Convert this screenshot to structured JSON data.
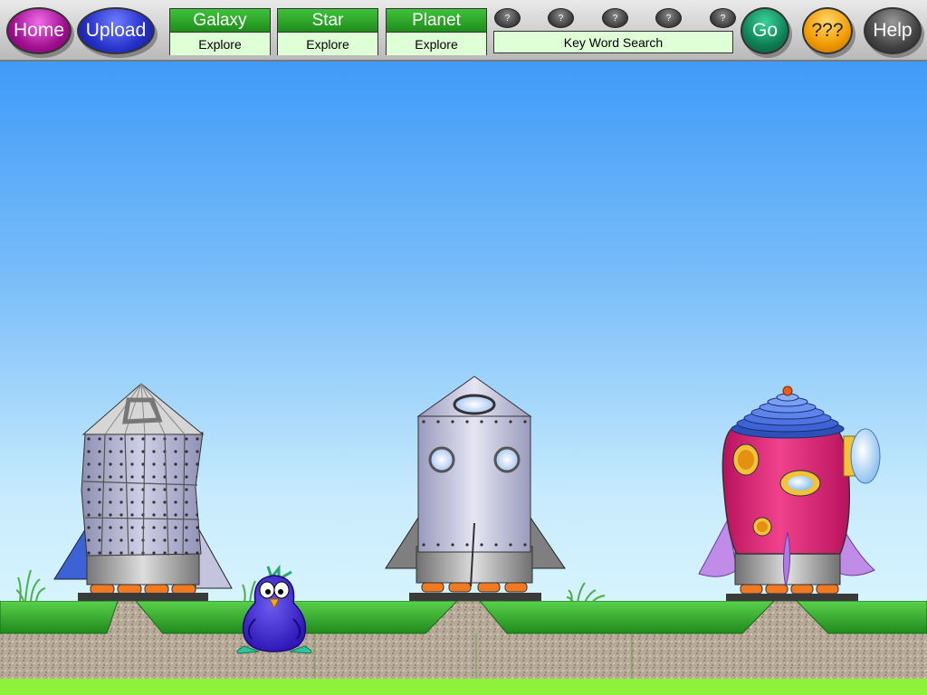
{
  "toolbar": {
    "home_label": "Home",
    "upload_label": "Upload",
    "galaxy": {
      "title": "Galaxy",
      "action": "Explore"
    },
    "star": {
      "title": "Star",
      "action": "Explore"
    },
    "planet": {
      "title": "Planet",
      "action": "Explore"
    },
    "question_buttons": [
      "?",
      "?",
      "?",
      "?",
      "?"
    ],
    "search_label": "Key Word Search",
    "go_label": "Go",
    "mystery_label": "???",
    "help_label": "Help"
  },
  "scene": {
    "rockets": [
      "riveted-rocket",
      "silver-rocket",
      "pink-rocket"
    ],
    "character": "penguin-mascot"
  },
  "colors": {
    "home": "#a0108f",
    "upload": "#2430c8",
    "go": "#0f8056",
    "mystery": "#f09a00",
    "help": "#444444",
    "explore_header": "#1f8d1c",
    "explore_sub": "#dfffd6",
    "sky_top": "#3f9bf9",
    "sky_bottom": "#d7f4fe",
    "grass": "#2ea22a",
    "rocket_pink": "#e0337c"
  }
}
